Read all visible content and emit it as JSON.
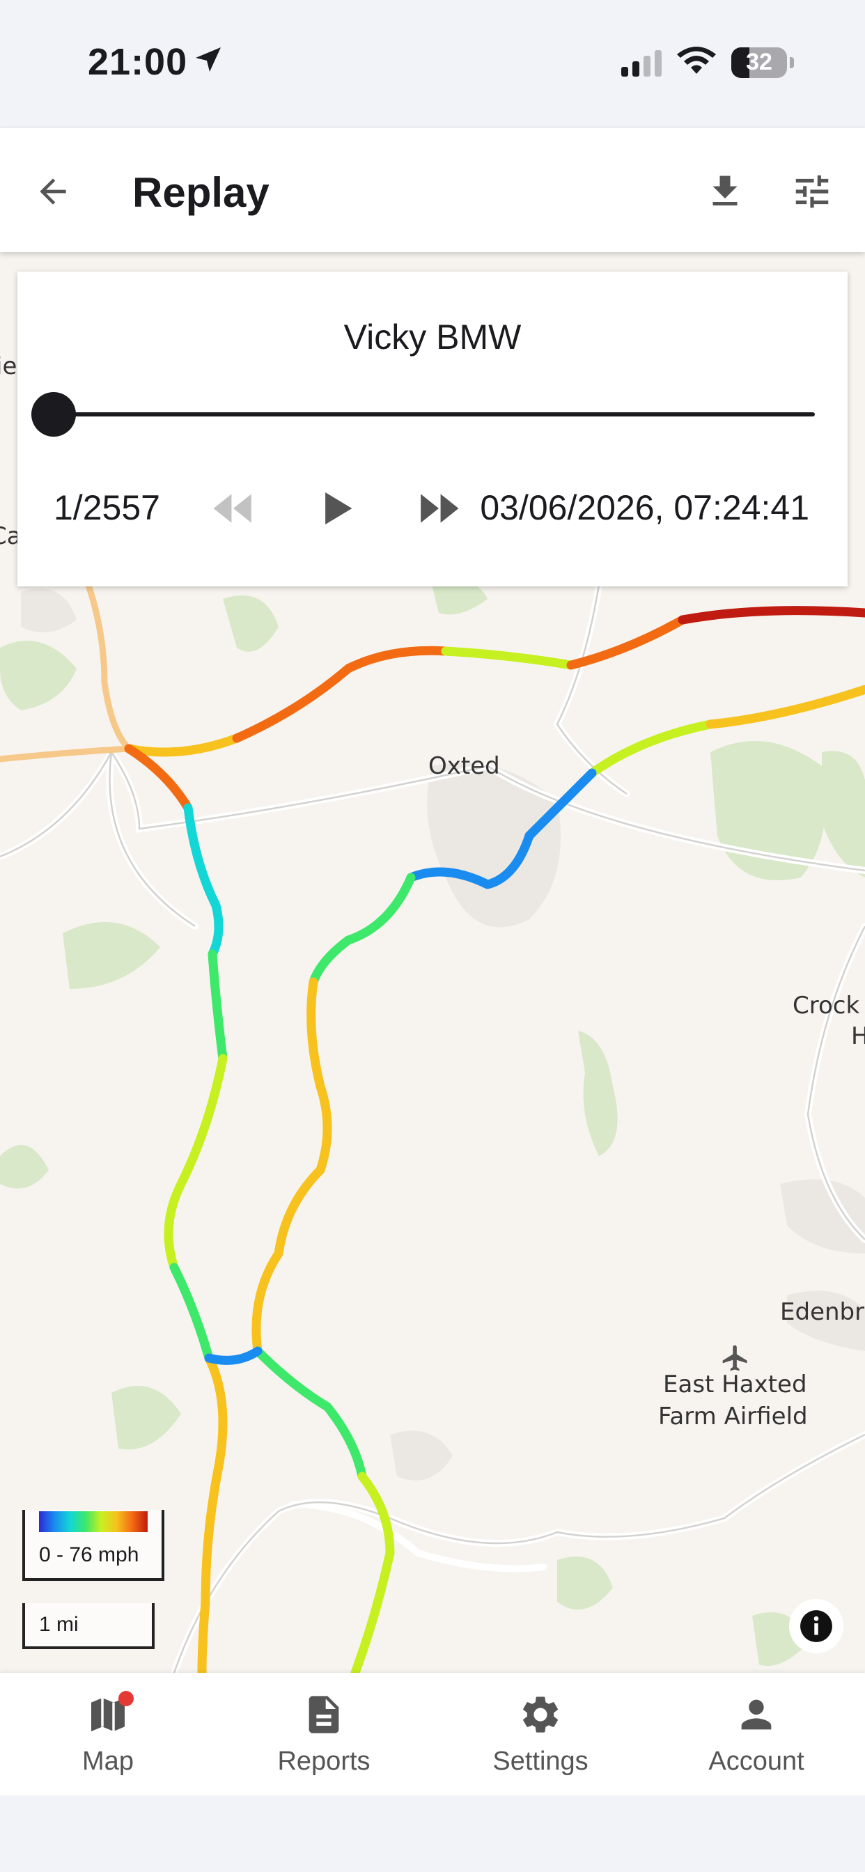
{
  "status_bar": {
    "time": "21:00",
    "battery": "32",
    "icons": [
      "location-arrow-icon",
      "signal-icon",
      "wifi-icon",
      "battery-icon"
    ]
  },
  "app_bar": {
    "title": "Replay",
    "icons": [
      "back-arrow-icon",
      "download-icon",
      "tune-icon"
    ]
  },
  "replay_card": {
    "vehicle_name": "Vicky BMW",
    "position": 1,
    "total": 2557,
    "counter": "1/2557",
    "timestamp": "03/06/2026, 07:24:41",
    "progress": 0.0,
    "controls": [
      "rewind-icon",
      "play-icon",
      "fast-forward-icon"
    ]
  },
  "map": {
    "labels": {
      "oxted": "Oxted",
      "crock": "Crock",
      "crock_h": "H",
      "edenbr": "Edenbr",
      "airfield_line1": "East Haxted",
      "airfield_line2": "Farm Airfield",
      "edge_ie": "ie",
      "edge_ca": "Ca"
    },
    "legend": {
      "text": "0 - 76 mph",
      "min_mph": 0,
      "max_mph": 76,
      "colors": [
        "#2b2ad6",
        "#1a8cf0",
        "#13d6d6",
        "#3de86b",
        "#c7f020",
        "#f7c21e",
        "#f26b13",
        "#c01b10"
      ]
    },
    "scale": "1 mi"
  },
  "bottom_nav": {
    "items": [
      {
        "label": "Map",
        "icon": "map-icon",
        "badge": true
      },
      {
        "label": "Reports",
        "icon": "document-icon",
        "badge": false
      },
      {
        "label": "Settings",
        "icon": "gear-icon",
        "badge": false
      },
      {
        "label": "Account",
        "icon": "person-icon",
        "badge": false
      }
    ]
  }
}
